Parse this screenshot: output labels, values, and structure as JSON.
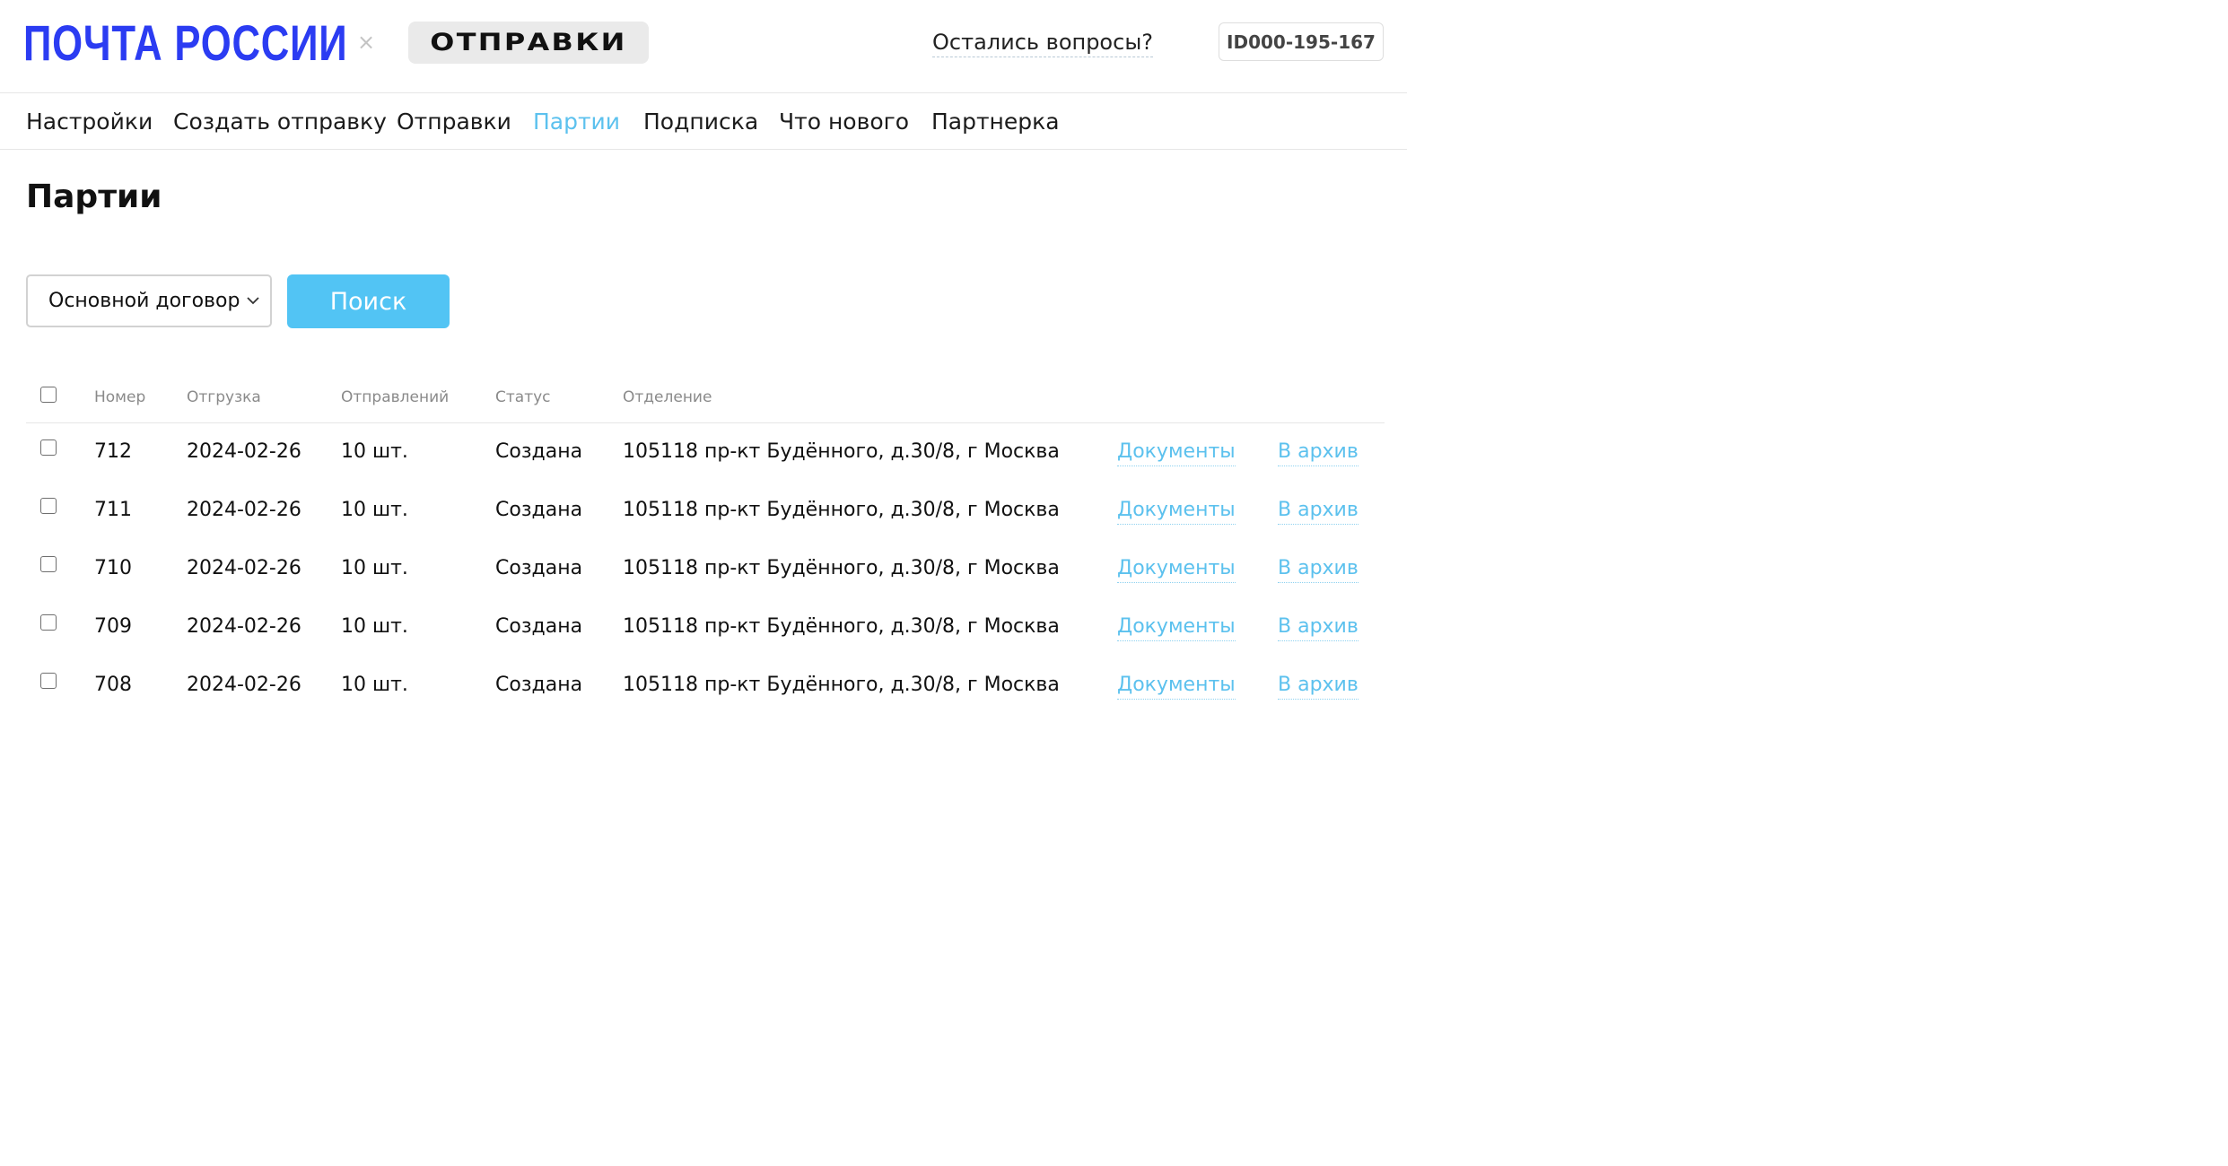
{
  "header": {
    "logo": "ПОЧТА РОССИИ",
    "separator": "×",
    "product_badge": "ОТПРАВКИ",
    "questions_link": "Остались вопросы?",
    "account_id": "ID000-195-167"
  },
  "nav": {
    "items": [
      {
        "label": "Настройки"
      },
      {
        "label": "Создать отправку"
      },
      {
        "label": "Отправки"
      },
      {
        "label": "Партии",
        "active": true
      },
      {
        "label": "Подписка"
      },
      {
        "label": "Что нового"
      },
      {
        "label": "Партнерка"
      }
    ]
  },
  "page": {
    "title": "Партии"
  },
  "filters": {
    "contract_select_value": "Основной договор",
    "search_button": "Поиск"
  },
  "table": {
    "columns": [
      "Номер",
      "Отгрузка",
      "Отправлений",
      "Статус",
      "Отделение"
    ],
    "rows": [
      {
        "number": "712",
        "date": "2024-02-26",
        "count": "10 шт.",
        "status": "Создана",
        "office": "105118 пр-кт Будённого, д.30/8, г Москва",
        "docs": "Документы",
        "archive": "В архив"
      },
      {
        "number": "711",
        "date": "2024-02-26",
        "count": "10 шт.",
        "status": "Создана",
        "office": "105118 пр-кт Будённого, д.30/8, г Москва",
        "docs": "Документы",
        "archive": "В архив"
      },
      {
        "number": "710",
        "date": "2024-02-26",
        "count": "10 шт.",
        "status": "Создана",
        "office": "105118 пр-кт Будённого, д.30/8, г Москва",
        "docs": "Документы",
        "archive": "В архив"
      },
      {
        "number": "709",
        "date": "2024-02-26",
        "count": "10 шт.",
        "status": "Создана",
        "office": "105118 пр-кт Будённого, д.30/8, г Москва",
        "docs": "Документы",
        "archive": "В архив"
      },
      {
        "number": "708",
        "date": "2024-02-26",
        "count": "10 шт.",
        "status": "Создана",
        "office": "105118 пр-кт Будённого, д.30/8, г Москва",
        "docs": "Документы",
        "archive": "В архив"
      }
    ]
  },
  "colors": {
    "brand_blue": "#2b3cf2",
    "accent": "#5cc1ee",
    "button": "#52c4f4"
  }
}
